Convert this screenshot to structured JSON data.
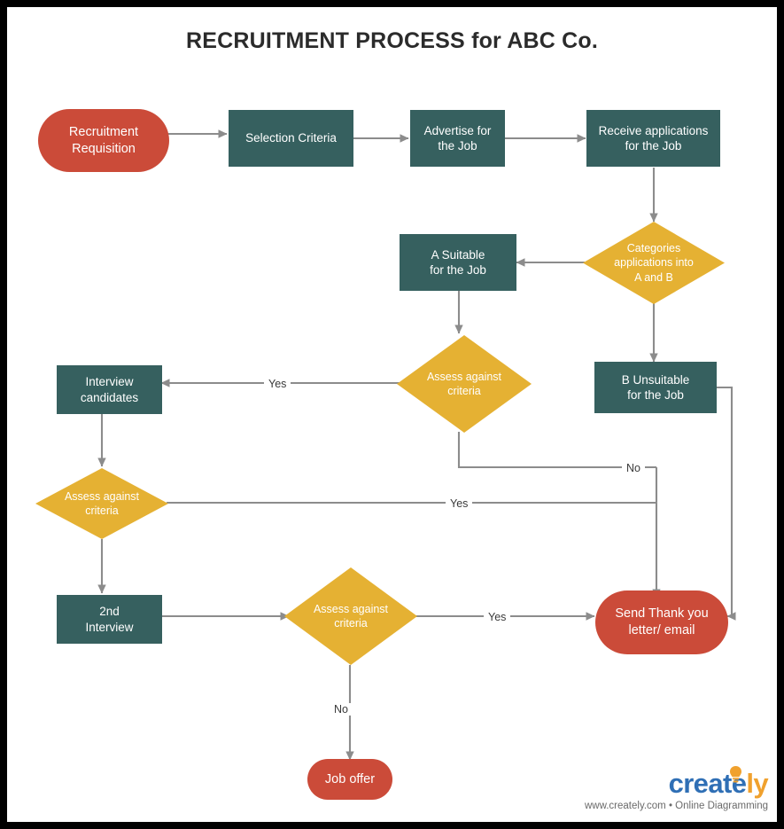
{
  "diagram": {
    "title": "RECRUITMENT PROCESS for ABC Co.",
    "colors": {
      "terminator": "#CB4B39",
      "process": "#36605F",
      "decision": "#E5B133",
      "connector": "#8C8C8C",
      "label_text": "#3A3A3A",
      "title_text": "#2B2B2B",
      "frame": "#000000",
      "sheet": "#FFFFFF"
    },
    "nodes": [
      {
        "id": "recruitment-requisition",
        "shape": "terminator",
        "text": "Recruitment\nRequisition"
      },
      {
        "id": "selection-criteria",
        "shape": "process",
        "text": "Selection Criteria"
      },
      {
        "id": "advertise-for-the-job",
        "shape": "process",
        "text": "Advertise for\nthe Job"
      },
      {
        "id": "receive-applications",
        "shape": "process",
        "text": "Receive applications\nfor the Job"
      },
      {
        "id": "categories-applications",
        "shape": "decision",
        "text": "Categories\napplications into\nA and B"
      },
      {
        "id": "a-suitable",
        "shape": "process",
        "text": "A Suitable\nfor the Job"
      },
      {
        "id": "b-unsuitable",
        "shape": "process",
        "text": "B Unsuitable\nfor the Job"
      },
      {
        "id": "assess-against-criteria-1",
        "shape": "decision",
        "text": "Assess against\ncriteria"
      },
      {
        "id": "interview-candidates",
        "shape": "process",
        "text": "Interview\ncandidates"
      },
      {
        "id": "assess-against-criteria-2",
        "shape": "decision",
        "text": "Assess against\ncriteria"
      },
      {
        "id": "second-interview",
        "shape": "process",
        "text": "2nd\nInterview"
      },
      {
        "id": "assess-against-criteria-3",
        "shape": "decision",
        "text": "Assess against\ncriteria"
      },
      {
        "id": "send-thank-you",
        "shape": "terminator",
        "text": "Send Thank you\nletter/ email"
      },
      {
        "id": "job-offer",
        "shape": "terminator",
        "text": "Job offer"
      }
    ],
    "edge_labels": {
      "assess1_yes": "Yes",
      "assess1_no": "No",
      "assess2_yes": "Yes",
      "assess3_yes": "Yes",
      "assess3_no": "No"
    }
  },
  "footer": {
    "brand_part1": "create",
    "brand_part2": "ly",
    "tagline": "www.creately.com • Online Diagramming"
  }
}
